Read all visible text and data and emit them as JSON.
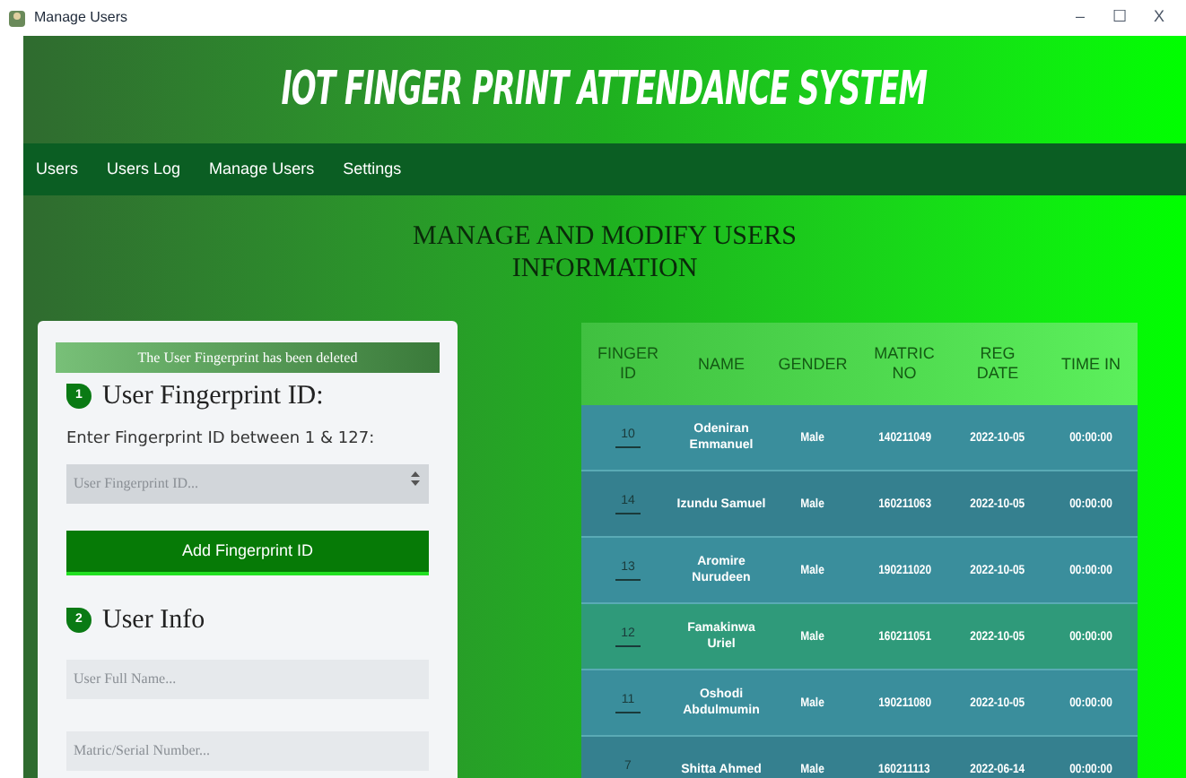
{
  "window": {
    "title": "Manage Users",
    "controls": [
      "–",
      "☐",
      "X"
    ]
  },
  "header": {
    "title": "IOT FINGER PRINT ATTENDANCE SYSTEM"
  },
  "nav": [
    "Users",
    "Users Log",
    "Manage Users",
    "Settings"
  ],
  "heading": "MANAGE AND MODIFY USERS INFORMATION",
  "form": {
    "alert": "The User Fingerprint has been deleted",
    "section_1": {
      "number": "1",
      "title": "User Fingerprint ID:"
    },
    "id_label": "Enter Fingerprint ID between 1 & 127:",
    "id_field": {
      "placeholder": "User Fingerprint ID..."
    },
    "add_button": "Add Fingerprint ID",
    "section_2": {
      "number": "2",
      "title": "User Info"
    },
    "name_field": {
      "placeholder": "User Full Name..."
    },
    "matric_field": {
      "placeholder": "Matric/Serial Number..."
    }
  },
  "table": {
    "columns": [
      [
        "FINGER",
        "ID"
      ],
      [
        "NAME"
      ],
      [
        "GENDER"
      ],
      [
        "MATRIC",
        "NO"
      ],
      [
        "REG",
        "DATE"
      ],
      [
        "TIME IN"
      ]
    ],
    "rows": [
      {
        "finger_id": "10",
        "name": "Odeniran Emmanuel",
        "gender": "Male",
        "matric_no": "140211049",
        "reg_date": "2022-10-05",
        "time_in": "00:00:00",
        "selected": false
      },
      {
        "finger_id": "14",
        "name": "Izundu Samuel",
        "gender": "Male",
        "matric_no": "160211063",
        "reg_date": "2022-10-05",
        "time_in": "00:00:00",
        "selected": false
      },
      {
        "finger_id": "13",
        "name": "Aromire Nurudeen",
        "gender": "Male",
        "matric_no": "190211020",
        "reg_date": "2022-10-05",
        "time_in": "00:00:00",
        "selected": false
      },
      {
        "finger_id": "12",
        "name": "Famakinwa Uriel",
        "gender": "Male",
        "matric_no": "160211051",
        "reg_date": "2022-10-05",
        "time_in": "00:00:00",
        "selected": true
      },
      {
        "finger_id": "11",
        "name": "Oshodi Abdulmumin",
        "gender": "Male",
        "matric_no": "190211080",
        "reg_date": "2022-10-05",
        "time_in": "00:00:00",
        "selected": false
      },
      {
        "finger_id": "7",
        "name": "Shitta Ahmed",
        "gender": "Male",
        "matric_no": "160211113",
        "reg_date": "2022-06-14",
        "time_in": "00:00:00",
        "selected": false
      }
    ]
  }
}
